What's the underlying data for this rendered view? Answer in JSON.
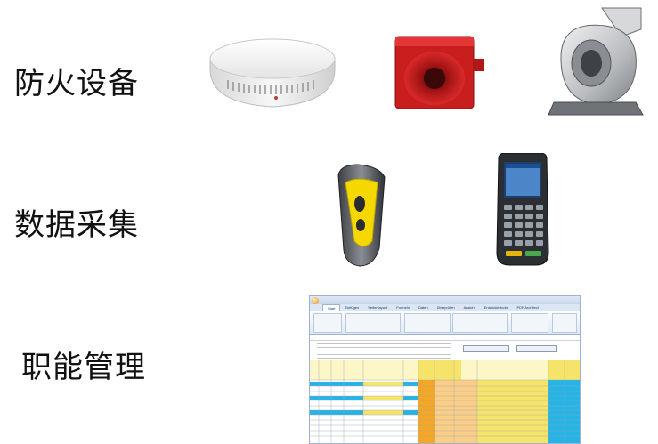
{
  "rows": [
    {
      "label": "防火设备"
    },
    {
      "label": "数据采集"
    },
    {
      "label": "职能管理"
    }
  ],
  "excel": {
    "ribbon_tabs": [
      "Start",
      "Einfügen",
      "Seitenlayout",
      "Formeln",
      "Daten",
      "Überprüfen",
      "Ansicht",
      "Entwicklertools",
      "PDF Architect"
    ],
    "active_tab": "Start"
  },
  "colors": {
    "label_text": "#111111",
    "excel_yellow": "#f6e46a",
    "excel_orange": "#f5a623",
    "excel_blue": "#26b4e6"
  }
}
